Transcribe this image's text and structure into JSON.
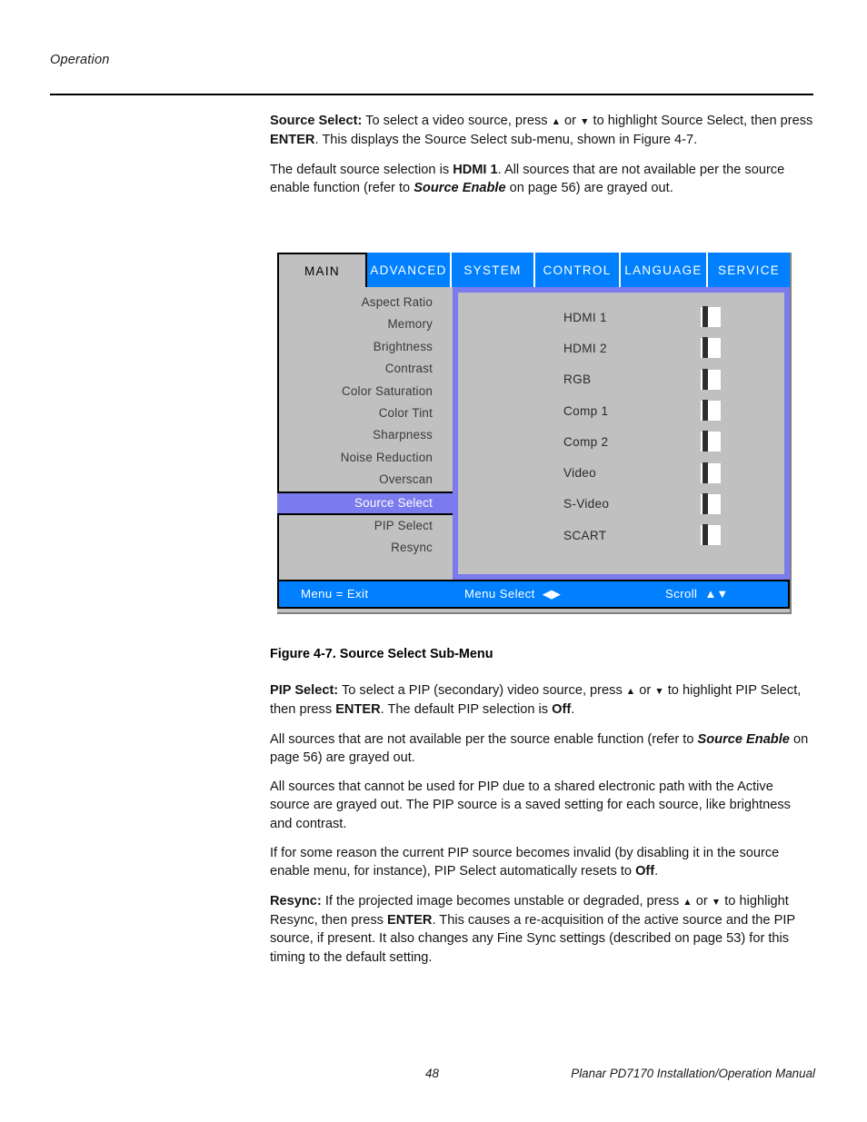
{
  "page": {
    "running_head": "Operation",
    "footer_page_number": "48",
    "footer_manual": "Planar PD7170 Installation/Operation Manual"
  },
  "colors": {
    "tab_inactive_bg": "#0080ff",
    "tab_active_bg": "#c0c0c0",
    "menu_bg": "#c0c0c0",
    "highlight": "#7b7bee",
    "statusbar_bg": "#0080ff",
    "text_dark": "#2b2b2b"
  },
  "intro": {
    "p1_lead": "Source Select:",
    "p1_a": " To select a video source, press ",
    "p1_or": " or ",
    "p1_b": " to highlight Source Select, then press ",
    "p1_enter": "ENTER",
    "p1_c": ". This displays the Source Select sub-menu, shown in Figure 4-7.",
    "p2_a": "The default source selection is ",
    "p2_hdmi": "HDMI 1",
    "p2_b": ". All sources that are not available per the source enable function (refer to ",
    "p2_source_enable": "Source Enable",
    "p2_c": " on page 56) are grayed out."
  },
  "osd": {
    "tabs": [
      {
        "label": "MAIN",
        "active": true
      },
      {
        "label": "ADVANCED",
        "active": false
      },
      {
        "label": "SYSTEM",
        "active": false
      },
      {
        "label": "CONTROL",
        "active": false
      },
      {
        "label": "LANGUAGE",
        "active": false
      },
      {
        "label": "SERVICE",
        "active": false
      }
    ],
    "menu_items": [
      {
        "label": "Aspect Ratio",
        "selected": false
      },
      {
        "label": "Memory",
        "selected": false
      },
      {
        "label": "Brightness",
        "selected": false
      },
      {
        "label": "Contrast",
        "selected": false
      },
      {
        "label": "Color Saturation",
        "selected": false
      },
      {
        "label": "Color Tint",
        "selected": false
      },
      {
        "label": "Sharpness",
        "selected": false
      },
      {
        "label": "Noise Reduction",
        "selected": false
      },
      {
        "label": "Overscan",
        "selected": false
      },
      {
        "label": "Source Select",
        "selected": true
      },
      {
        "label": "PIP Select",
        "selected": false
      },
      {
        "label": "Resync",
        "selected": false
      }
    ],
    "sources": [
      {
        "label": "HDMI 1",
        "checked": false
      },
      {
        "label": "HDMI 2",
        "checked": false
      },
      {
        "label": "RGB",
        "checked": false
      },
      {
        "label": "Comp 1",
        "checked": false
      },
      {
        "label": "Comp 2",
        "checked": false
      },
      {
        "label": "Video",
        "checked": false
      },
      {
        "label": "S-Video",
        "checked": false
      },
      {
        "label": "SCART",
        "checked": false
      }
    ],
    "statusbar": {
      "exit": "Menu = Exit",
      "select": "Menu Select",
      "select_glyphs": "◀▶",
      "scroll": "Scroll",
      "scroll_glyphs": "▲▼"
    }
  },
  "figure": {
    "caption": "Figure 4-7. Source Select Sub-Menu"
  },
  "body": {
    "pip_lead": "PIP Select:",
    "pip_a": " To select a PIP (secondary) video source, press ",
    "pip_or": " or ",
    "pip_b": " to highlight PIP Select, then press ",
    "pip_enter": "ENTER",
    "pip_c": ". The default PIP selection is ",
    "pip_off": "Off",
    "pip_d": ".",
    "p_grayed_a": "All sources that are not available per the source enable function (refer to ",
    "p_grayed_source_enable": "Source Enable",
    "p_grayed_b": " on page 56) are grayed out.",
    "p_shared": "All sources that cannot be used for PIP due to a shared electronic path with the Active source are grayed out. The PIP source is a saved setting for each source, like brightness and contrast.",
    "p_invalid_a": "If for some reason the current PIP source becomes invalid (by disabling it in the source enable menu, for instance), PIP Select automatically resets to ",
    "p_invalid_off": "Off",
    "p_invalid_b": ".",
    "resync_lead": "Resync:",
    "resync_a": " If the projected image becomes unstable or degraded, press ",
    "resync_or": " or ",
    "resync_b": " to highlight Resync, then press ",
    "resync_enter": "ENTER",
    "resync_c": ". This causes a re-acquisition of the active source and the PIP source, if present. It also changes any Fine Sync settings (described on page 53) for this timing to the default setting."
  }
}
